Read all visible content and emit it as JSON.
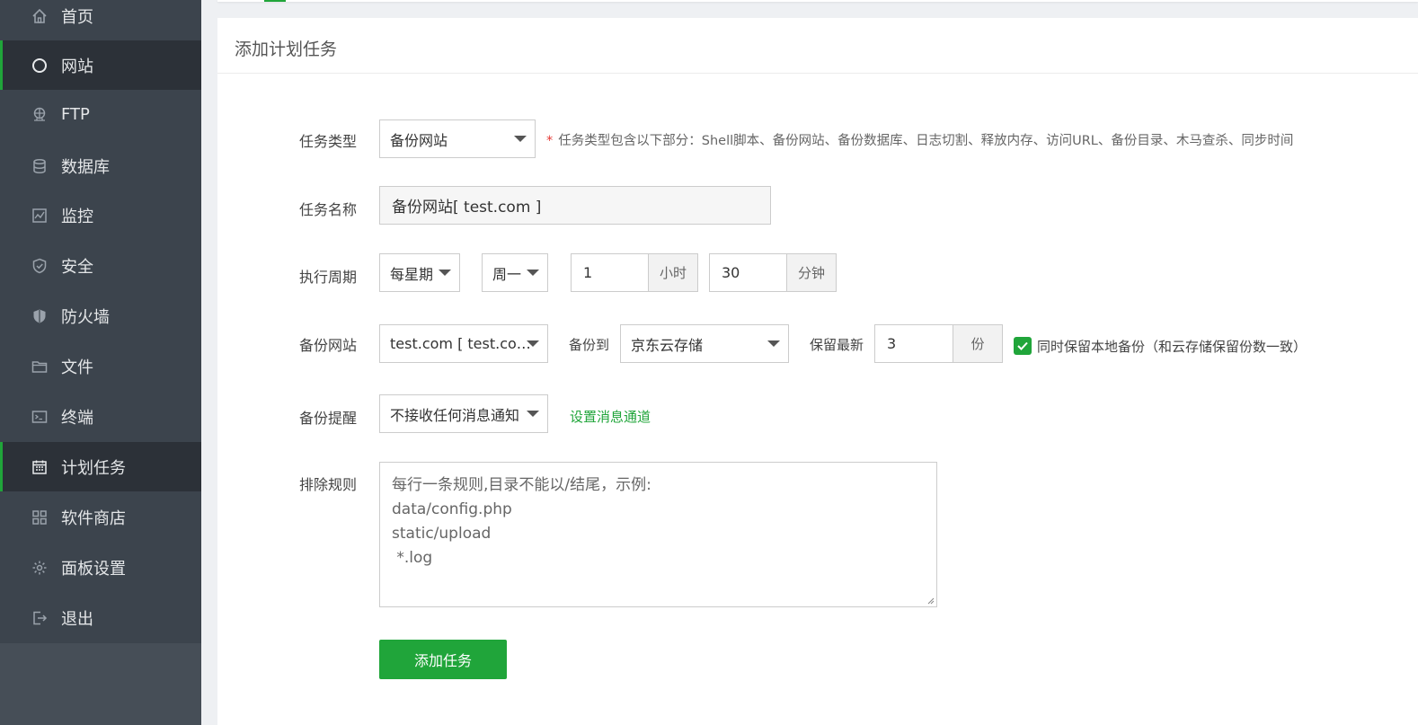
{
  "sidebar": {
    "items": [
      {
        "label": "首页",
        "icon": "home-icon",
        "active": false
      },
      {
        "label": "网站",
        "icon": "globe-icon",
        "active": true
      },
      {
        "label": "FTP",
        "icon": "ftp-icon",
        "active": false
      },
      {
        "label": "数据库",
        "icon": "database-icon",
        "active": false
      },
      {
        "label": "监控",
        "icon": "monitor-icon",
        "active": false
      },
      {
        "label": "安全",
        "icon": "shield-check-icon",
        "active": false
      },
      {
        "label": "防火墙",
        "icon": "firewall-icon",
        "active": false
      },
      {
        "label": "文件",
        "icon": "folder-icon",
        "active": false
      },
      {
        "label": "终端",
        "icon": "terminal-icon",
        "active": false
      },
      {
        "label": "计划任务",
        "icon": "calendar-icon",
        "active": true
      },
      {
        "label": "软件商店",
        "icon": "apps-grid-icon",
        "active": false
      },
      {
        "label": "面板设置",
        "icon": "gear-icon",
        "active": false
      },
      {
        "label": "退出",
        "icon": "logout-icon",
        "active": false
      }
    ]
  },
  "panel": {
    "title": "添加计划任务"
  },
  "form": {
    "task_type": {
      "label": "任务类型",
      "value": "备份网站",
      "hint_star": "*",
      "hint": "任务类型包含以下部分：Shell脚本、备份网站、备份数据库、日志切割、释放内存、访问URL、备份目录、木马查杀、同步时间"
    },
    "task_name": {
      "label": "任务名称",
      "value": "备份网站[ test.com ]"
    },
    "cycle": {
      "label": "执行周期",
      "period": "每星期",
      "weekday": "周一",
      "hour": "1",
      "hour_unit": "小时",
      "minute": "30",
      "minute_unit": "分钟"
    },
    "backup_site": {
      "label": "备份网站",
      "value": "test.com [ test.com ]",
      "backup_to_label": "备份到",
      "backup_to": "京东云存储",
      "keep_label": "保留最新",
      "keep_value": "3",
      "keep_unit": "份",
      "local_checked": true,
      "local_label": "同时保留本地备份（和云存储保留份数一致）"
    },
    "notify": {
      "label": "备份提醒",
      "value": "不接收任何消息通知",
      "link": "设置消息通道"
    },
    "exclude": {
      "label": "排除规则",
      "lines": [
        "每行一条规则,目录不能以/结尾，示例:",
        "data/config.php",
        "static/upload",
        " *.log"
      ]
    },
    "submit": "添加任务"
  },
  "colors": {
    "accent": "#20a53a",
    "sidebar_bg": "#3c444d",
    "sidebar_active_bg": "#2c3138",
    "required_star": "#e53935"
  }
}
